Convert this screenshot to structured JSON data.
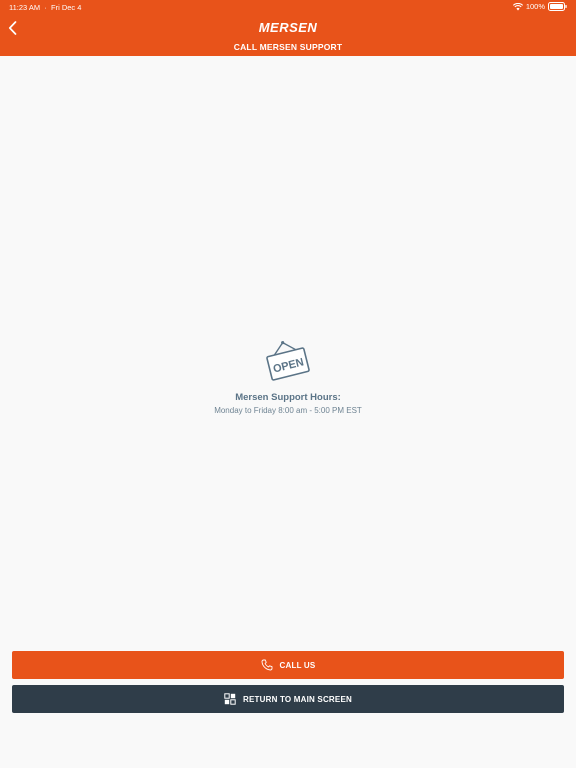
{
  "status_bar": {
    "time": "11:23 AM",
    "date": "Fri Dec 4",
    "battery": "100%"
  },
  "header": {
    "logo": "Mersen",
    "title": "CALL MERSEN SUPPORT"
  },
  "sign": {
    "text": "OPEN"
  },
  "support": {
    "title": "Mersen Support Hours:",
    "hours": "Monday to Friday 8:00 am - 5:00 PM EST"
  },
  "buttons": {
    "call": "CALL US",
    "main": "RETURN TO MAIN SCREEN"
  },
  "colors": {
    "brand_orange": "#e8531a",
    "dark_button": "#2f3d49",
    "text_slate": "#5b7487",
    "background": "#f9f9f9"
  },
  "icons": {
    "back": "chevron-left-icon",
    "wifi": "wifi-icon",
    "battery": "battery-icon",
    "sign": "open-sign-icon",
    "call": "phone-icon",
    "main": "grid-icon"
  }
}
